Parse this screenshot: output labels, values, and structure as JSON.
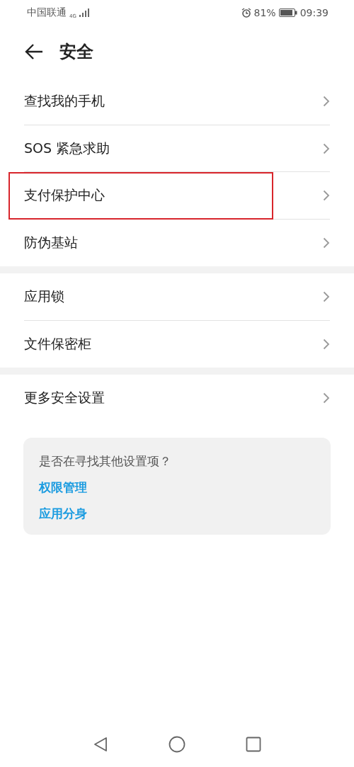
{
  "status_bar": {
    "carrier": "中国联通",
    "network": "4G",
    "battery_percent": "81%",
    "time": "09:39"
  },
  "header": {
    "title": "安全"
  },
  "groups": [
    {
      "items": [
        {
          "label": "查找我的手机",
          "highlighted": false
        },
        {
          "label": "SOS 紧急求助",
          "highlighted": false
        },
        {
          "label": "支付保护中心",
          "highlighted": true
        },
        {
          "label": "防伪基站",
          "highlighted": false
        }
      ]
    },
    {
      "items": [
        {
          "label": "应用锁",
          "highlighted": false
        },
        {
          "label": "文件保密柜",
          "highlighted": false
        }
      ]
    },
    {
      "items": [
        {
          "label": "更多安全设置",
          "highlighted": false
        }
      ]
    }
  ],
  "suggestion_card": {
    "question": "是否在寻找其他设置项？",
    "links": [
      "权限管理",
      "应用分身"
    ]
  }
}
